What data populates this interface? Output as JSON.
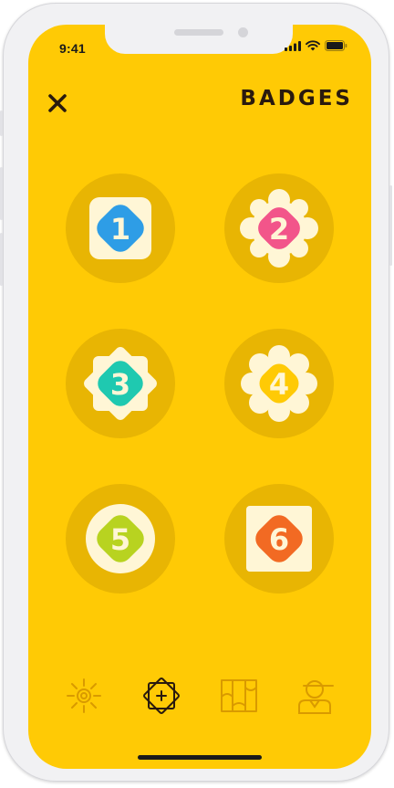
{
  "status_bar": {
    "time": "9:41"
  },
  "header": {
    "title": "BADGES"
  },
  "badges": [
    {
      "number": "1",
      "color": "#2E9DE6",
      "shape": "rounded-diamond"
    },
    {
      "number": "2",
      "color": "#F2558A",
      "shape": "scalloped-flower"
    },
    {
      "number": "3",
      "color": "#1FC9B0",
      "shape": "star-burst"
    },
    {
      "number": "4",
      "color": "#FFCA05",
      "shape": "scalloped-flower"
    },
    {
      "number": "5",
      "color": "#B8D320",
      "shape": "circle-diamond"
    },
    {
      "number": "6",
      "color": "#F26A23",
      "shape": "rounded-square"
    }
  ],
  "tabs": [
    {
      "icon": "sun-icon",
      "active": false
    },
    {
      "icon": "badges-icon",
      "active": true
    },
    {
      "icon": "map-icon",
      "active": false
    },
    {
      "icon": "profile-icon",
      "active": false
    }
  ],
  "colors": {
    "background": "#FFCA05",
    "badge_ring": "#E8B503",
    "badge_cream": "#FFF6D6",
    "tab_inactive": "#D99A00",
    "tab_active": "#2A1A0E"
  }
}
